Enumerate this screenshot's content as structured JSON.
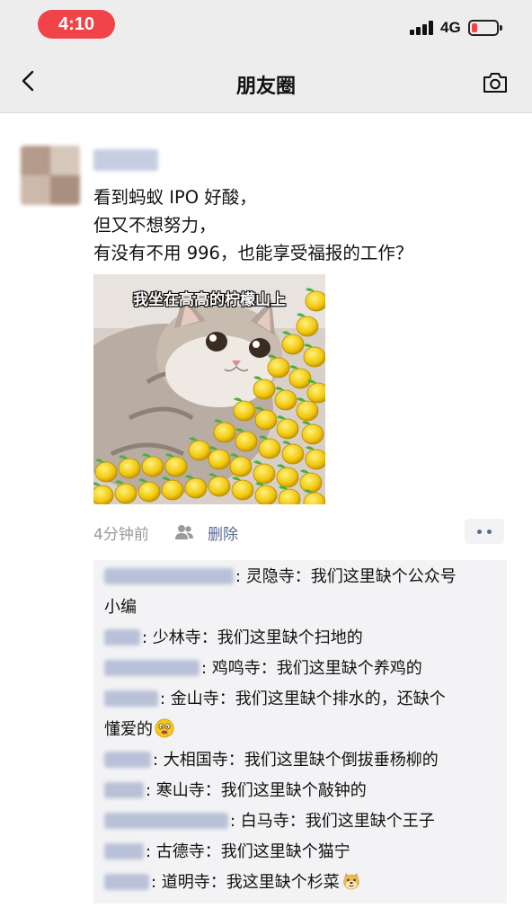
{
  "status_bar": {
    "time": "4:10",
    "network": "4G"
  },
  "nav": {
    "title": "朋友圈",
    "back_icon": "chevron-left-icon",
    "camera_icon": "camera-icon"
  },
  "post": {
    "text_lines": [
      "看到蚂蚁 IPO 好酸，",
      "但又不想努力，",
      "有没有不用 996，也能享受福报的工作？"
    ],
    "image_caption": "我坐在高高的柠檬山上",
    "time_ago": "4分钟前",
    "delete_label": "删除"
  },
  "comments": [
    {
      "text": ": 灵隐寺：我们这里缺个公众号",
      "text2": "小编"
    },
    {
      "text": ": 少林寺：我们这里缺个扫地的"
    },
    {
      "text": ": 鸡鸣寺：我们这里缺个养鸡的"
    },
    {
      "text": ": 金山寺：我们这里缺个排水的，还缺个",
      "text2": "懂爱的",
      "emoji": "drooling-face-emoji"
    },
    {
      "text": ": 大相国寺：我们这里缺个倒拔垂杨柳的"
    },
    {
      "text": ": 寒山寺：我们这里缺个敲钟的"
    },
    {
      "text": ": 白马寺：我们这里缺个王子"
    },
    {
      "text": ": 古德寺：我们这里缺个猫宁"
    },
    {
      "text": ": 道明寺：我这里缺个杉菜",
      "emoji": "doge-emoji"
    }
  ],
  "colors": {
    "accent_link": "#576b95",
    "time_pill": "#f0444a",
    "comment_bg": "#f3f3f5"
  }
}
